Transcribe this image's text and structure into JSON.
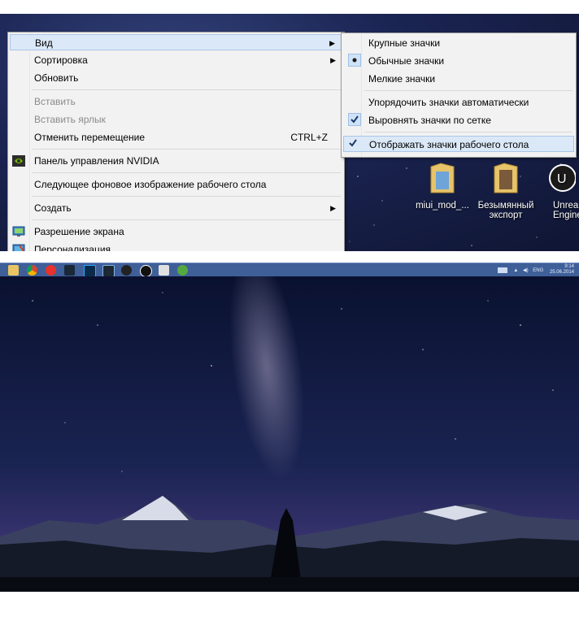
{
  "context_menu": {
    "items": [
      {
        "label": "Вид",
        "submenu": true,
        "highlighted": true
      },
      {
        "label": "Сортировка",
        "submenu": true
      },
      {
        "label": "Обновить"
      },
      {
        "label": "Вставить",
        "disabled": true
      },
      {
        "label": "Вставить ярлык",
        "disabled": true
      },
      {
        "label": "Отменить перемещение",
        "shortcut": "CTRL+Z"
      },
      {
        "label": "Панель управления NVIDIA",
        "icon": "nvidia-icon"
      },
      {
        "label": "Следующее фоновое изображение рабочего стола"
      },
      {
        "label": "Создать",
        "submenu": true
      },
      {
        "label": "Разрешение экрана",
        "icon": "display-icon"
      },
      {
        "label": "Персонализация",
        "icon": "personalize-icon"
      }
    ]
  },
  "view_submenu": {
    "items": [
      {
        "label": "Крупные значки"
      },
      {
        "label": "Обычные значки",
        "mark": "radio"
      },
      {
        "label": "Мелкие значки"
      },
      {
        "label": "Упорядочить значки автоматически"
      },
      {
        "label": "Выровнять значки по сетке",
        "mark": "check"
      },
      {
        "label": "Отображать значки рабочего стола",
        "mark": "check",
        "highlighted": true
      }
    ]
  },
  "desktop_icons": [
    {
      "label": "miui_mod_...",
      "icon": "folder-icon"
    },
    {
      "label1": "Безымянный",
      "label2": "экспорт",
      "icon": "folder-icon"
    },
    {
      "label1": "Unrea",
      "label2": "Engine",
      "icon": "unreal-engine-icon"
    }
  ],
  "taskbar": {
    "apps": [
      "explorer-icon",
      "chrome-icon",
      "yandex-icon",
      "steam-icon",
      "photoshop-icon",
      "lightroom-icon",
      "app-icon",
      "unreal-icon",
      "figure-icon",
      "utorrent-icon"
    ],
    "tray": {
      "lang": "ENG",
      "time": "9:14",
      "date": "25.06.2014"
    }
  },
  "colors": {
    "highlight": "#dbe8f7",
    "menu_bg": "#f2f2f2",
    "taskbar": "#3f5f99"
  }
}
